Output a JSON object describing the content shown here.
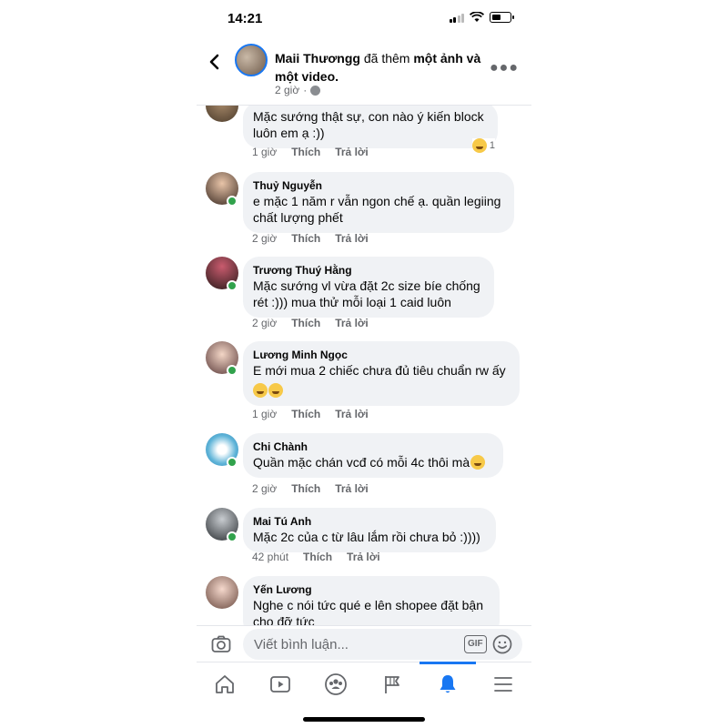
{
  "status_bar": {
    "time": "14:21"
  },
  "post_header": {
    "author": "Maii Thươngg",
    "action_prefix": "đã thêm",
    "action_bold": "một ảnh và một video.",
    "time": "2 giờ"
  },
  "comments": [
    {
      "name": "",
      "lines": [
        "Mặc sướng thật sự, con nào ý kiến block",
        "luôn em ạ :))"
      ],
      "time": "1 giờ",
      "like": "Thích",
      "reply": "Trả lời",
      "reaction_count": "1",
      "emoji_count": 0
    },
    {
      "name": "Thuỷ Nguyễn",
      "lines": [
        "e mặc 1 năm r vẫn ngon chế ạ. quần legiing",
        "chất lượng phết"
      ],
      "time": "2 giờ",
      "like": "Thích",
      "reply": "Trả lời",
      "emoji_count": 0
    },
    {
      "name": "Trương Thuý Hằng",
      "lines": [
        "Mặc sướng vl vừa đặt 2c size bíe chống",
        "rét :))) mua thử mỗi loại 1 caid luôn"
      ],
      "time": "2 giờ",
      "like": "Thích",
      "reply": "Trả lời",
      "emoji_count": 0
    },
    {
      "name": "Lương Minh Ngọc",
      "lines": [
        "E mới mua 2 chiếc chưa đủ tiêu chuẩn rw ấy"
      ],
      "time": "1 giờ",
      "like": "Thích",
      "reply": "Trả lời",
      "emoji_count": 2
    },
    {
      "name": "Chi Chành",
      "lines": [
        "Quần mặc chán vcđ có mỗi 4c thôi mà"
      ],
      "time": "2 giờ",
      "like": "Thích",
      "reply": "Trả lời",
      "emoji_count": 1
    },
    {
      "name": "Mai Tú Anh",
      "lines": [
        "Mặc 2c của c từ lâu lắm rồi chưa bỏ :))))"
      ],
      "time": "42 phút",
      "like": "Thích",
      "reply": "Trả lời",
      "emoji_count": 0
    },
    {
      "name": "Yến Lương",
      "lines": [
        "Nghe c nói tức qué e lên shopee đặt bận",
        "cho đỡ tức"
      ],
      "time": "",
      "like": "",
      "reply": "",
      "emoji_count": 0
    }
  ],
  "composer": {
    "placeholder": "Viết bình luận...",
    "gif_label": "GIF"
  },
  "colors": {
    "accent": "#1877f2",
    "bubble": "#f0f2f5",
    "online": "#31a24c",
    "muted": "#65676b"
  },
  "icons": {
    "back": "chevron-left-icon",
    "more": "more-horizontal-icon",
    "camera": "camera-icon",
    "gif": "gif-icon",
    "sticker": "smiley-icon",
    "tabs": [
      "home-icon",
      "video-icon",
      "groups-icon",
      "flag-icon",
      "bell-icon",
      "menu-icon"
    ]
  }
}
